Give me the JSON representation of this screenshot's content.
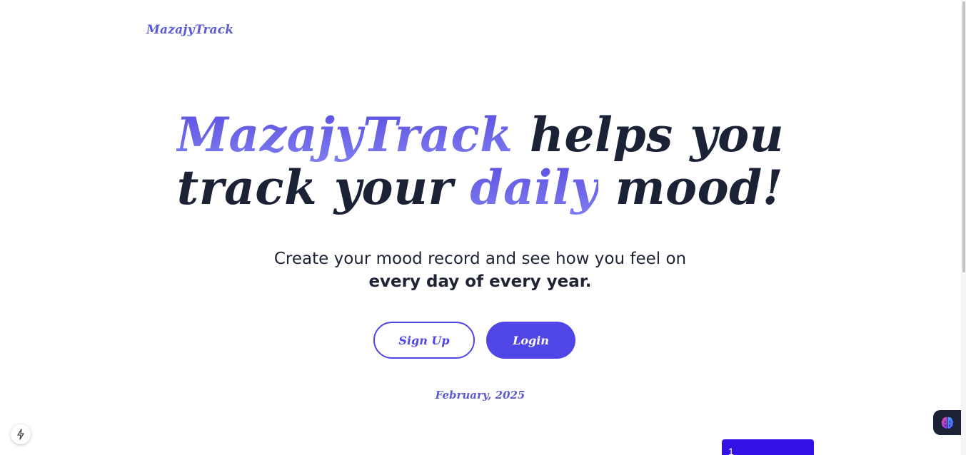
{
  "header": {
    "logo": "MazajyTrack"
  },
  "hero": {
    "brand": "MazajyTrack",
    "part1": "helps you",
    "part2": "track your",
    "accent2": "daily",
    "part3": "mood!"
  },
  "subtitle": {
    "line1": "Create your mood record and see how you feel on",
    "line2": "every day of every year."
  },
  "actions": {
    "signup_label": "Sign Up",
    "login_label": "Login"
  },
  "calendar": {
    "month_label": "February, 2025",
    "first_day": "1"
  },
  "icons": {
    "bolt": "lightning-bolt-icon",
    "brain": "brain-icon"
  },
  "colors": {
    "brand": "#4f46e5",
    "text_dark": "#1b2236",
    "day_card": "#3410e6"
  }
}
